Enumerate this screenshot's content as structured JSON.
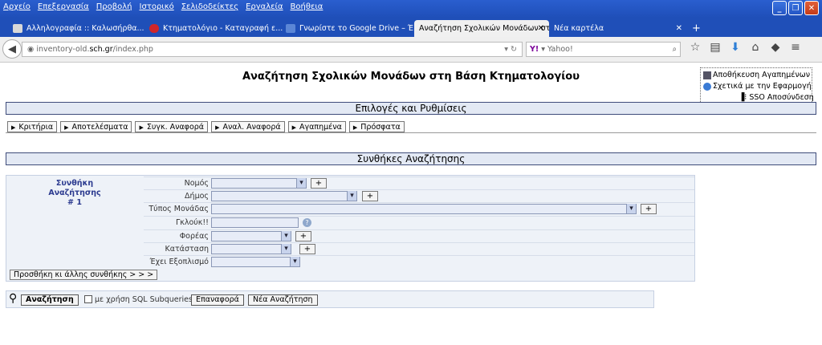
{
  "menu": [
    "Αρχείο",
    "Επεξεργασία",
    "Προβολή",
    "Ιστορικό",
    "Σελιδοδείκτες",
    "Εργαλεία",
    "Βοήθεια"
  ],
  "tabs": [
    {
      "title": "Αλληλογραφία :: Καλωσήρθα...",
      "icon_color": "#c9c9c9"
    },
    {
      "title": "Κτηματολόγιο - Καταγραφή ε...",
      "icon_color": "#d0262b"
    },
    {
      "title": "Γνωρίστε το Google Drive – Έ...",
      "icon_color": "#5b86d6"
    },
    {
      "title": "Αναζήτηση Σχολικών Μονάδων στ...",
      "icon_color": "#f0f0f0"
    },
    {
      "title": "Νέα καρτέλα",
      "icon_color": "#1f4fb8"
    }
  ],
  "new_tab": "+",
  "url": {
    "prefix": "inventory-old.",
    "host": "sch.gr",
    "path": "/index.php"
  },
  "search": {
    "engine_mark": "Y!",
    "placeholder": "Yahoo!"
  },
  "page_title": "Αναζήτηση Σχολικών Μονάδων στη Βάση Κτηματολογίου",
  "popup": {
    "save_favorites": "Αποθήκευση Αγαπημένων",
    "about": "Σχετικά με την Εφαρμογή",
    "sso_logout": "SSO Αποσύνδεση"
  },
  "options_header": "Επιλογές και Ρυθμίσεις",
  "subtabs": [
    "Κριτήρια",
    "Αποτελέσματα",
    "Συγκ. Αναφορά",
    "Αναλ. Αναφορά",
    "Αγαπημένα",
    "Πρόσφατα"
  ],
  "conditions_header": "Συνθήκες Αναζήτησης",
  "condition": {
    "title_line1": "Συνθήκη",
    "title_line2": "Αναζήτησης",
    "title_line3": "# 1",
    "fields": {
      "nomos": "Νομός",
      "dimos": "Δήμος",
      "typos": "Τύπος Μονάδας",
      "gkloyk": "Γκλούκ!!",
      "foreas": "Φορέας",
      "katastasi": "Κατάσταση",
      "exoplismos": "Έχει Εξοπλισμό"
    }
  },
  "add_condition": "Προσθήκη κι άλλης συνθήκης > > >",
  "actions": {
    "search": "Αναζήτηση",
    "sql_label": "με χρήση SQL Subqueries",
    "reset": "Επαναφορά",
    "new_search": "Νέα Αναζήτηση"
  }
}
